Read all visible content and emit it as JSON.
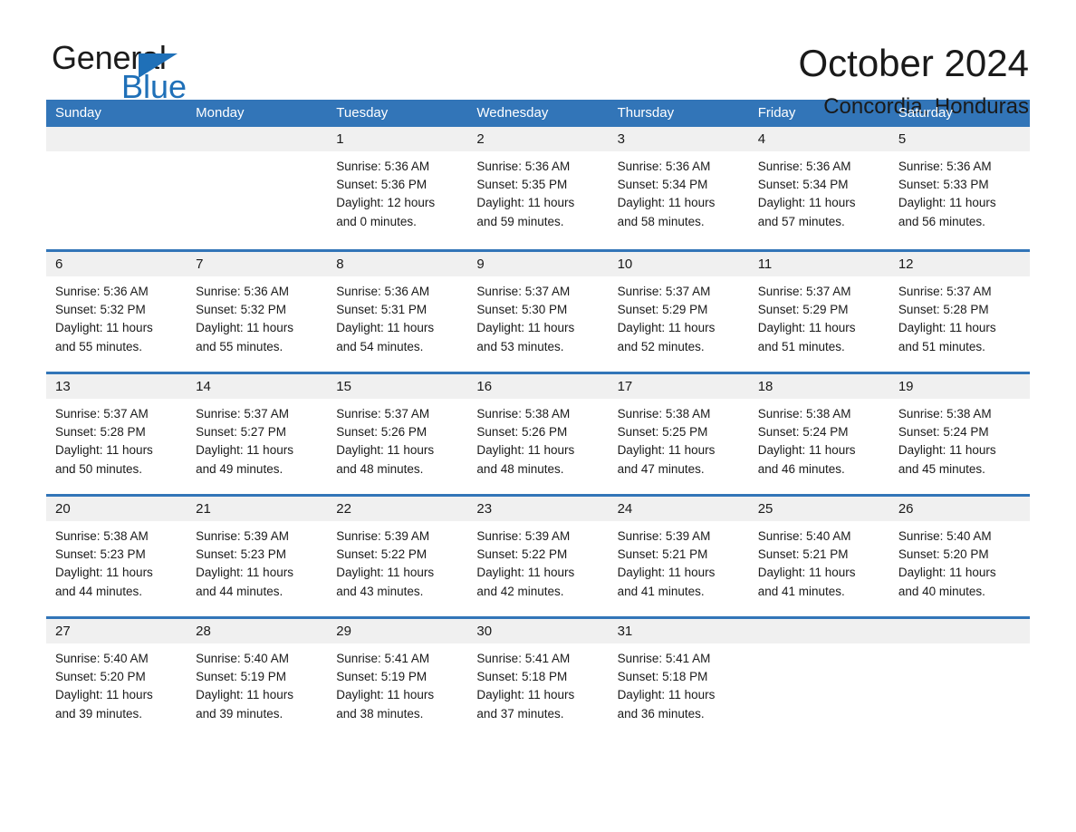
{
  "brand": {
    "name_part1": "General",
    "name_part2": "Blue",
    "accent_color": "#1f70b8"
  },
  "header": {
    "month_title": "October 2024",
    "location": "Concordia, Honduras"
  },
  "calendar": {
    "header_color": "#3275b8",
    "weekdays": [
      "Sunday",
      "Monday",
      "Tuesday",
      "Wednesday",
      "Thursday",
      "Friday",
      "Saturday"
    ],
    "weeks": [
      [
        {
          "day": "",
          "lines": []
        },
        {
          "day": "",
          "lines": []
        },
        {
          "day": "1",
          "lines": [
            "Sunrise: 5:36 AM",
            "Sunset: 5:36 PM",
            "Daylight: 12 hours",
            "and 0 minutes."
          ]
        },
        {
          "day": "2",
          "lines": [
            "Sunrise: 5:36 AM",
            "Sunset: 5:35 PM",
            "Daylight: 11 hours",
            "and 59 minutes."
          ]
        },
        {
          "day": "3",
          "lines": [
            "Sunrise: 5:36 AM",
            "Sunset: 5:34 PM",
            "Daylight: 11 hours",
            "and 58 minutes."
          ]
        },
        {
          "day": "4",
          "lines": [
            "Sunrise: 5:36 AM",
            "Sunset: 5:34 PM",
            "Daylight: 11 hours",
            "and 57 minutes."
          ]
        },
        {
          "day": "5",
          "lines": [
            "Sunrise: 5:36 AM",
            "Sunset: 5:33 PM",
            "Daylight: 11 hours",
            "and 56 minutes."
          ]
        }
      ],
      [
        {
          "day": "6",
          "lines": [
            "Sunrise: 5:36 AM",
            "Sunset: 5:32 PM",
            "Daylight: 11 hours",
            "and 55 minutes."
          ]
        },
        {
          "day": "7",
          "lines": [
            "Sunrise: 5:36 AM",
            "Sunset: 5:32 PM",
            "Daylight: 11 hours",
            "and 55 minutes."
          ]
        },
        {
          "day": "8",
          "lines": [
            "Sunrise: 5:36 AM",
            "Sunset: 5:31 PM",
            "Daylight: 11 hours",
            "and 54 minutes."
          ]
        },
        {
          "day": "9",
          "lines": [
            "Sunrise: 5:37 AM",
            "Sunset: 5:30 PM",
            "Daylight: 11 hours",
            "and 53 minutes."
          ]
        },
        {
          "day": "10",
          "lines": [
            "Sunrise: 5:37 AM",
            "Sunset: 5:29 PM",
            "Daylight: 11 hours",
            "and 52 minutes."
          ]
        },
        {
          "day": "11",
          "lines": [
            "Sunrise: 5:37 AM",
            "Sunset: 5:29 PM",
            "Daylight: 11 hours",
            "and 51 minutes."
          ]
        },
        {
          "day": "12",
          "lines": [
            "Sunrise: 5:37 AM",
            "Sunset: 5:28 PM",
            "Daylight: 11 hours",
            "and 51 minutes."
          ]
        }
      ],
      [
        {
          "day": "13",
          "lines": [
            "Sunrise: 5:37 AM",
            "Sunset: 5:28 PM",
            "Daylight: 11 hours",
            "and 50 minutes."
          ]
        },
        {
          "day": "14",
          "lines": [
            "Sunrise: 5:37 AM",
            "Sunset: 5:27 PM",
            "Daylight: 11 hours",
            "and 49 minutes."
          ]
        },
        {
          "day": "15",
          "lines": [
            "Sunrise: 5:37 AM",
            "Sunset: 5:26 PM",
            "Daylight: 11 hours",
            "and 48 minutes."
          ]
        },
        {
          "day": "16",
          "lines": [
            "Sunrise: 5:38 AM",
            "Sunset: 5:26 PM",
            "Daylight: 11 hours",
            "and 48 minutes."
          ]
        },
        {
          "day": "17",
          "lines": [
            "Sunrise: 5:38 AM",
            "Sunset: 5:25 PM",
            "Daylight: 11 hours",
            "and 47 minutes."
          ]
        },
        {
          "day": "18",
          "lines": [
            "Sunrise: 5:38 AM",
            "Sunset: 5:24 PM",
            "Daylight: 11 hours",
            "and 46 minutes."
          ]
        },
        {
          "day": "19",
          "lines": [
            "Sunrise: 5:38 AM",
            "Sunset: 5:24 PM",
            "Daylight: 11 hours",
            "and 45 minutes."
          ]
        }
      ],
      [
        {
          "day": "20",
          "lines": [
            "Sunrise: 5:38 AM",
            "Sunset: 5:23 PM",
            "Daylight: 11 hours",
            "and 44 minutes."
          ]
        },
        {
          "day": "21",
          "lines": [
            "Sunrise: 5:39 AM",
            "Sunset: 5:23 PM",
            "Daylight: 11 hours",
            "and 44 minutes."
          ]
        },
        {
          "day": "22",
          "lines": [
            "Sunrise: 5:39 AM",
            "Sunset: 5:22 PM",
            "Daylight: 11 hours",
            "and 43 minutes."
          ]
        },
        {
          "day": "23",
          "lines": [
            "Sunrise: 5:39 AM",
            "Sunset: 5:22 PM",
            "Daylight: 11 hours",
            "and 42 minutes."
          ]
        },
        {
          "day": "24",
          "lines": [
            "Sunrise: 5:39 AM",
            "Sunset: 5:21 PM",
            "Daylight: 11 hours",
            "and 41 minutes."
          ]
        },
        {
          "day": "25",
          "lines": [
            "Sunrise: 5:40 AM",
            "Sunset: 5:21 PM",
            "Daylight: 11 hours",
            "and 41 minutes."
          ]
        },
        {
          "day": "26",
          "lines": [
            "Sunrise: 5:40 AM",
            "Sunset: 5:20 PM",
            "Daylight: 11 hours",
            "and 40 minutes."
          ]
        }
      ],
      [
        {
          "day": "27",
          "lines": [
            "Sunrise: 5:40 AM",
            "Sunset: 5:20 PM",
            "Daylight: 11 hours",
            "and 39 minutes."
          ]
        },
        {
          "day": "28",
          "lines": [
            "Sunrise: 5:40 AM",
            "Sunset: 5:19 PM",
            "Daylight: 11 hours",
            "and 39 minutes."
          ]
        },
        {
          "day": "29",
          "lines": [
            "Sunrise: 5:41 AM",
            "Sunset: 5:19 PM",
            "Daylight: 11 hours",
            "and 38 minutes."
          ]
        },
        {
          "day": "30",
          "lines": [
            "Sunrise: 5:41 AM",
            "Sunset: 5:18 PM",
            "Daylight: 11 hours",
            "and 37 minutes."
          ]
        },
        {
          "day": "31",
          "lines": [
            "Sunrise: 5:41 AM",
            "Sunset: 5:18 PM",
            "Daylight: 11 hours",
            "and 36 minutes."
          ]
        },
        {
          "day": "",
          "lines": []
        },
        {
          "day": "",
          "lines": []
        }
      ]
    ]
  }
}
